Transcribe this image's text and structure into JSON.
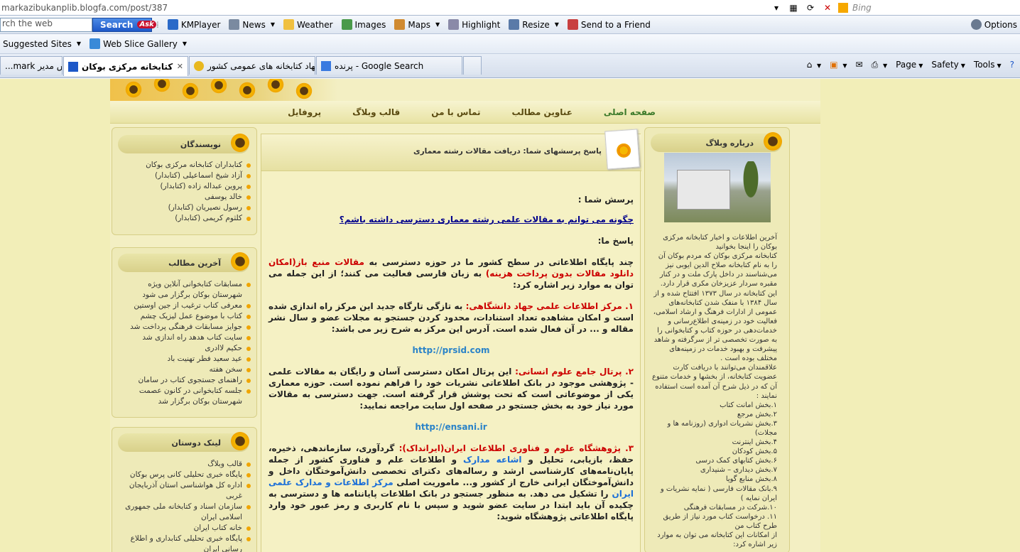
{
  "browser": {
    "address_url": "markazibukanplib.blogfa.com/post/387",
    "bing_placeholder": "Bing",
    "ask_toolbar": {
      "search_placeholder": "rch the web",
      "search_label": "Search",
      "ask_logo": "Ask",
      "items": [
        "KMPlayer",
        "News",
        "Weather",
        "Images",
        "Maps",
        "Highlight",
        "Resize",
        "Send to a Friend"
      ],
      "options": "Options"
    },
    "favorites": [
      "Suggested Sites",
      "Web Slice Gallery"
    ],
    "tabs": [
      {
        "label": "بخش مدیر mark..."
      },
      {
        "label": "کتابخانه مرکزی بوکان"
      },
      {
        "label": "نهاد کتابخانه های عمومی کشور"
      },
      {
        "label": "پرنده - Google Search"
      }
    ],
    "command_bar": [
      "Page",
      "Safety",
      "Tools"
    ],
    "colors": {
      "accent": "#1d58c8",
      "page_bg": "#f2eeb8"
    }
  },
  "blog": {
    "nav": [
      "صفحه اصلی",
      "عناوین مطالب",
      "تماس با من",
      "قالب وبلاگ",
      "پروفایل"
    ],
    "writers": {
      "title": "نویسندگان",
      "items": [
        "کتابداران کتابخانه مرکزی بوکان",
        "آزاد شیخ اسماعیلی (کتابدار)",
        "پروین عبداله زاده (کتابدار)",
        "خالد یوسفی",
        "رسول نصیریان (کتابدار)",
        "کلثوم کریمی (کتابدار)"
      ]
    },
    "latest": {
      "title": "آخرین مطالب",
      "items": [
        "مسابقات کتابخوانی آنلاین ویژه شهرستان بوکان برگزار می شود",
        "معرفی کتاب ترغیب از جین اوستین",
        "کتاب با موضوع عمل لیزیک چشم",
        "جوایز مسابقات فرهنگی پرداخت شد",
        "سایت کتاب هدهد راه اندازی شد",
        "حکیم لاادری",
        "عید سعید فطر تهنیت باد",
        "سخن هفته",
        "راهنمای جستجوی کتاب در سامان",
        "جلسه کتابخوانی در کانون عصمت شهرستان بوکان برگزار شد"
      ]
    },
    "links": {
      "title": "لینک دوستان",
      "items": [
        "قالب وبلاگ",
        "پایگاه خبری تحلیلی کانی پرس بوکان",
        "اداره کل هواشناسی استان آذربایجان غربی",
        "سازمان اسناد و کتابخانه ملی جمهوری اسلامی ایران",
        "خانه کتاب ایران",
        "پایگاه خبری تحلیلی کتابداری و اطلاع رسانی ایران"
      ]
    },
    "post": {
      "title": "پاسخ پرسشهای شما: دریافت مقالات رشته معماری",
      "q_label": "پرسش شما :",
      "question": "چگونه می توانم به مقالات علمی رشته معماری دسترسی داشته باشم؟",
      "a_label": "پاسخ ما:",
      "intro_1": "چند پایگاه اطلاعاتی در سطح کشور ما در حوزه دسترسی به ",
      "intro_red": "مقالات منبع باز(امکان دانلود مقالات بدون پرداخت هزینه)",
      "intro_2": " به زبان فارسی فعالیت می کنند؛ از این جمله می توان به موارد زیر اشاره کرد:",
      "item1_red": "۱. مرکز اطلاعات علمی جهاد دانشگاهی:",
      "item1_text": " به تازگی تارگاه جدید این مرکز راه اندازی شده است و امکان مشاهده تعداد استنادات، محدود کردن جستجو به مجلات عضو و سال نشر مقاله و ... در آن فعال شده است. آدرس این مرکز به شرح زیر می باشد:",
      "item1_url": "http://prsid.com",
      "item2_red": "۲. پرتال جامع علوم انسانی:",
      "item2_text": " این پرتال امکان دسترسی آسان و رایگان به مقالات علمی - پژوهشی موجود در بانک اطلاعاتی نشریات خود را فراهم نموده است. حوزه معماری یکی از موضوعاتی است که تحت پوشش قرار گرفته است. جهت دسترسی به مقالات مورد نیاز خود به بخش جستجو در صفحه اول سایت مراجعه نمایید:",
      "item2_url": "http://ensani.ir",
      "item3_red": "۳. پژوهشگاه علوم و فناوری اطلاعات ایران(ایرانداک):",
      "item3_a": " گردآوری، سازماندهی، ذخیره، حفظ، بازیابی، تحلیل و ",
      "item3_blue1": "اشاعه مدارک",
      "item3_b": " و اطلاعات علم و فناوری کشور از جمله پایان‌نامه‌های کارشناسی ارشد و رساله‌های دکترای تخصصی دانش‌آموختگان داخل و دانش‌آموختگان ایرانی خارج از کشور و... ماموریت اصلی ",
      "item3_blue2": "مرکز اطلاعات و مدارک علمی ایران",
      "item3_c": " را تشکیل می دهد. به منظور جستجو در بانک اطلاعات پایاننامه ها و دسترسی به چکیده آن باید ابتدا در سایت عضو شوید و سپس با نام کاربری و رمز عبور خود وارد پایگاه اطلاعاتی پژوهشگاه شوید:"
    },
    "about": {
      "title": "درباره وبلاگ",
      "lines": [
        "آخرین اطلاعات و اخبار کتابخانه مرکزی بوکان را اینجا بخوانید",
        "کتابخانه مرکزی بوکان که مردم بوکان آن را به نام کتابخانه صلاح الدین ایوبی نیز می‌شناسند در داخل پارک ملت و در کنار مقبره سردار عزیزخان مکری قرار دارد. این کتابخانه در سال ۱۳۷۳ افتتاح شده و از سال ۱۳۸۴ با منفک شدن کتابخانه‌های عمومی از ادارات فرهنگ و ارشاد اسلامی، فعالیت خود در زمینه‌ی اطلاع‌رسانی و خدمات‌دهی در حوزه کتاب و کتابخوانی را به صورت تخصصی تر از سرگرفته و شاهد پیشرفت و بهبود خدمات در زمینه‌های مختلف بوده است .",
        "علاقمندان می‌توانند با دریافت کارت عضویت کتابخانه، از بخشها و خدمات متنوع آن که در ذیل شرح آن آمده است استفاده نمایند :",
        "۱.بخش امانت کتاب",
        "۲.بخش مرجع",
        "۳.بخش نشریات ادواری (روزنامه ها و مجلات)",
        "۴.بخش اینترنت",
        "۵.بخش کودکان",
        "۶.بخش کتابهای کمک درسی",
        "۷.بخش دیداری – شنیداری",
        "۸.بخش منابع گویا",
        "۹.بانک مقالات فارسی ( نمایه نشریات و ایران نمایه )",
        "۱۰.شرکت در مسابقات فرهنگی",
        "۱۱. درخواست کتاب مورد نیاز از طریق طرح کتاب من",
        "از امکانات این کتابخانه می توان به موارد زیر اشاره کرد:"
      ]
    }
  }
}
